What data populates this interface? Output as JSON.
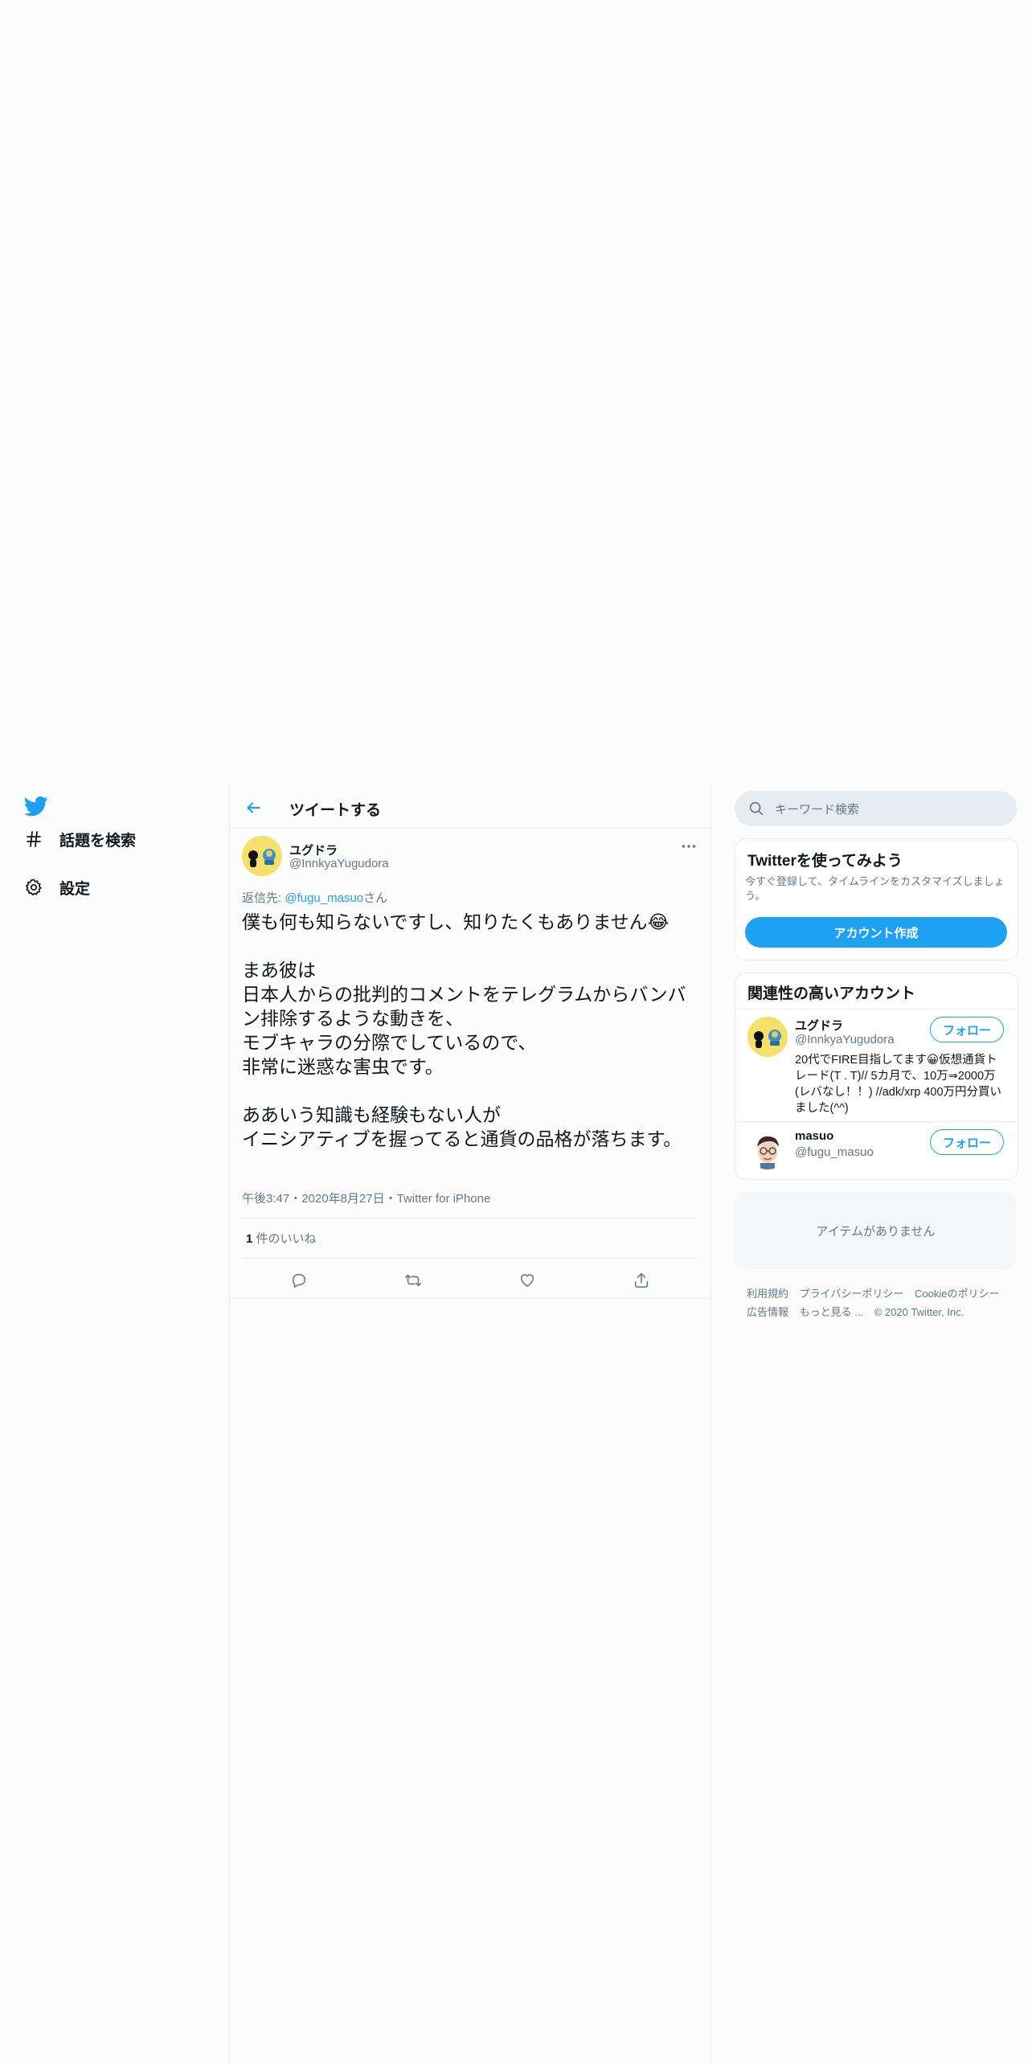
{
  "sidebar": {
    "items": [
      {
        "label": "話題を検索",
        "icon": "hashtag-icon"
      },
      {
        "label": "設定",
        "icon": "gear-icon"
      }
    ]
  },
  "header": {
    "title": "ツイートする"
  },
  "tweet": {
    "author_name": "ユグドラ",
    "author_handle": "@InnkyaYugudora",
    "reply_prefix": "返信先: ",
    "reply_target": "@fugu_masuo",
    "reply_suffix": "さん",
    "text": "僕も何も知らないですし、知りたくもありません😂\n\nまあ彼は\n日本人からの批判的コメントをテレグラムからバンバン排除するような動きを、\nモブキャラの分際でしているので、\n非常に迷惑な害虫です。\n\nああいう知識も経験もない人が\nイニシアティブを握ってると通貨の品格が落ちます。",
    "meta": "午後3:47・2020年8月27日・Twitter for iPhone",
    "likes_count": "1",
    "likes_label": " 件のいいね"
  },
  "search": {
    "placeholder": "キーワード検索"
  },
  "signup_card": {
    "title": "Twitterを使ってみよう",
    "description": "今すぐ登録して、タイムラインをカスタマイズしましょう。",
    "button": "アカウント作成"
  },
  "related": {
    "title": "関連性の高いアカウント",
    "accounts": [
      {
        "name": "ユグドラ",
        "handle": "@InnkyaYugudora",
        "bio": "20代でFIRE目指してます😀仮想通貨トレード(T . T)// 5カ月で、10万⇒2000万(レバなし！！) //adk/xrp 400万円分買いました(^^)",
        "follow": "フォロー"
      },
      {
        "name": "masuo",
        "handle": "@fugu_masuo",
        "bio": "",
        "follow": "フォロー"
      }
    ]
  },
  "empty_card": {
    "text": "アイテムがありません"
  },
  "footer": {
    "links": [
      "利用規約",
      "プライバシーポリシー",
      "Cookieのポリシー",
      "広告情報",
      "もっと見る ..."
    ],
    "copyright": "© 2020 Twitter, Inc."
  },
  "colors": {
    "accent": "#1da1f2",
    "text": "#14171a",
    "muted": "#657786",
    "border": "#e6ecf0"
  }
}
